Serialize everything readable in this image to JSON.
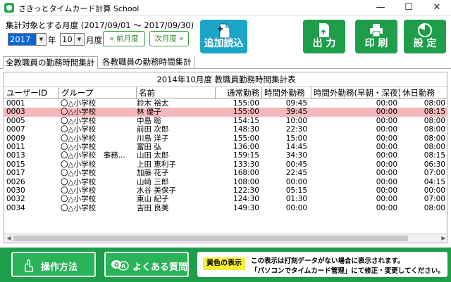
{
  "window": {
    "title": "さきっとタイムカード計算 School",
    "minimize": "—",
    "maximize": "☐",
    "close": "✕"
  },
  "toolbar": {
    "period_label": "集計対象とする月度 (2017/09/01 〜 2017/09/30)",
    "year": "2017",
    "year_unit": "年",
    "month": "10",
    "month_unit": "月度",
    "prev_month": "« 前月度",
    "next_month": "次月度 »",
    "add_read": "追加読込",
    "output": "出 力",
    "print": "印 刷",
    "settings": "設 定"
  },
  "tabs": [
    {
      "label": "全教職員の勤務時間集計",
      "active": true
    },
    {
      "label": "各教職員の勤務時間集計",
      "active": false
    }
  ],
  "table": {
    "title": "2014年10月度 教職員勤務時間集計表",
    "columns": [
      "ユーザーID",
      "グループ",
      "名前",
      "通常勤務",
      "時間外勤務",
      "時間外勤務(早朝・深夜)",
      "休日勤務"
    ],
    "rows": [
      {
        "id": "0001",
        "group": "〇△小学校",
        "name": "鈴木 裕太",
        "regular": "155:00",
        "overtime": "09:45",
        "night": "00:00",
        "holiday": "08:00",
        "highlight": false
      },
      {
        "id": "0003",
        "group": "〇△小学校",
        "name": "林 優子",
        "regular": "155:00",
        "overtime": "39:45",
        "night": "00:00",
        "holiday": "08:15",
        "highlight": true
      },
      {
        "id": "0005",
        "group": "〇△小学校",
        "name": "中島 聡",
        "regular": "154:15",
        "overtime": "10:00",
        "night": "00:00",
        "holiday": "08:00",
        "highlight": false
      },
      {
        "id": "0007",
        "group": "〇△小学校",
        "name": "前田 次郎",
        "regular": "148:30",
        "overtime": "22:30",
        "night": "00:00",
        "holiday": "08:00",
        "highlight": false
      },
      {
        "id": "0009",
        "group": "〇△小学校",
        "name": "川島 洋子",
        "regular": "155:00",
        "overtime": "15:00",
        "night": "00:00",
        "holiday": "08:00",
        "highlight": false
      },
      {
        "id": "0011",
        "group": "〇△小学校",
        "name": "富田 弘",
        "regular": "136:00",
        "overtime": "14:45",
        "night": "00:00",
        "holiday": "08:00",
        "highlight": false
      },
      {
        "id": "0013",
        "group": "〇△小学校　事務...",
        "name": "山田 太郎",
        "regular": "159:15",
        "overtime": "34:30",
        "night": "00:00",
        "holiday": "08:15",
        "highlight": false
      },
      {
        "id": "0015",
        "group": "〇△小学校",
        "name": "上田 恵利子",
        "regular": "133:30",
        "overtime": "00:45",
        "night": "00:00",
        "holiday": "06:30",
        "highlight": false
      },
      {
        "id": "0017",
        "group": "〇△小学校",
        "name": "加藤 花子",
        "regular": "168:00",
        "overtime": "22:45",
        "night": "00:00",
        "holiday": "07:00",
        "highlight": false
      },
      {
        "id": "0026",
        "group": "〇△小学校",
        "name": "山崎 三郎",
        "regular": "108:00",
        "overtime": "00:00",
        "night": "00:00",
        "holiday": "04:15",
        "highlight": false
      },
      {
        "id": "0030",
        "group": "〇△小学校",
        "name": "水谷 美保子",
        "regular": "122:30",
        "overtime": "05:15",
        "night": "00:00",
        "holiday": "00:00",
        "highlight": false
      },
      {
        "id": "0032",
        "group": "〇△小学校",
        "name": "東山 紀子",
        "regular": "124:30",
        "overtime": "01:30",
        "night": "00:00",
        "holiday": "07:00",
        "highlight": false
      },
      {
        "id": "0034",
        "group": "〇△小学校",
        "name": "吉田 良美",
        "regular": "149:30",
        "overtime": "00:00",
        "night": "00:00",
        "holiday": "08:00",
        "highlight": false
      }
    ]
  },
  "footer": {
    "manual": "操作方法",
    "faq": "よくある質問",
    "yellow_label": "黄色の表示",
    "notice_line1": "この表示は打刻データがない場合に表示されます。",
    "notice_line2": "「パソコンでタイムカード管理」にて修正・変更してください。"
  },
  "colors": {
    "brand_green": "#1e9e4a",
    "add_read_blue": "#1ba6c9",
    "highlight_row": "#f4b8b8",
    "notice_yellow": "#f7ee3a",
    "selected_blue": "#0a64d8"
  },
  "icons": [
    "app-icon",
    "add-file-icon",
    "output-file-icon",
    "printer-icon",
    "settings-dial-icon",
    "hand-pointer-icon",
    "qa-bubble-icon"
  ]
}
